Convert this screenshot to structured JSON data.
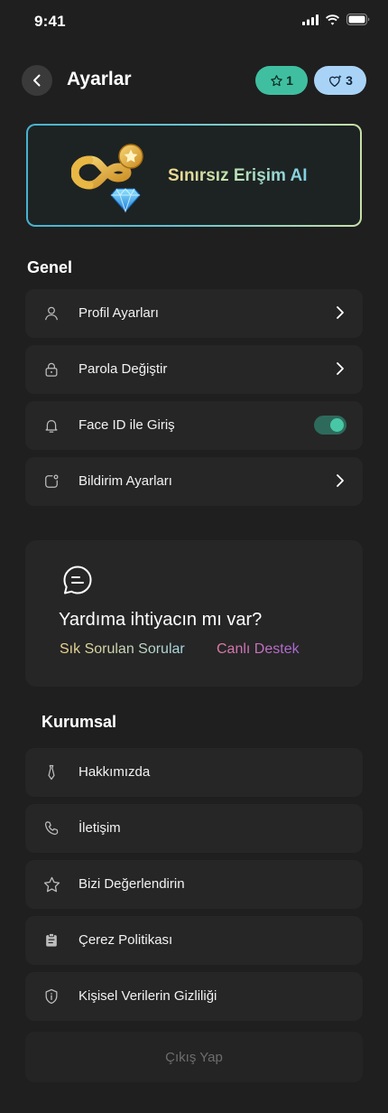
{
  "status_bar": {
    "time": "9:41"
  },
  "header": {
    "title": "Ayarlar",
    "star_count": "1",
    "heart_count": "3"
  },
  "promo": {
    "label": "Sınırsız Erişim AI"
  },
  "general": {
    "title": "Genel",
    "items": [
      {
        "label": "Profil Ayarları",
        "icon": "user-icon",
        "control": "chevron"
      },
      {
        "label": "Parola Değiştir",
        "icon": "lock-icon",
        "control": "chevron"
      },
      {
        "label": "Face ID ile Giriş",
        "icon": "bell-icon",
        "control": "toggle",
        "toggle_on": true
      },
      {
        "label": "Bildirim Ayarları",
        "icon": "notification-icon",
        "control": "chevron"
      }
    ]
  },
  "help": {
    "title": "Yardıma ihtiyacın mı var?",
    "faq_label": "Sık Sorulan Sorular",
    "live_label": "Canlı Destek"
  },
  "corporate": {
    "title": "Kurumsal",
    "items": [
      {
        "label": "Hakkımızda",
        "icon": "tie-icon"
      },
      {
        "label": "İletişim",
        "icon": "phone-icon"
      },
      {
        "label": "Bizi Değerlendirin",
        "icon": "star-icon"
      },
      {
        "label": "Çerez Politikası",
        "icon": "clipboard-icon"
      },
      {
        "label": "Kişisel Verilerin Gizliliği",
        "icon": "shield-icon"
      }
    ]
  },
  "logout": {
    "label": "Çıkış Yap"
  },
  "colors": {
    "background": "#1f1f1f",
    "row_background": "#262626",
    "accent_green": "#3fbfa0",
    "accent_blue": "#a9d3f6"
  }
}
